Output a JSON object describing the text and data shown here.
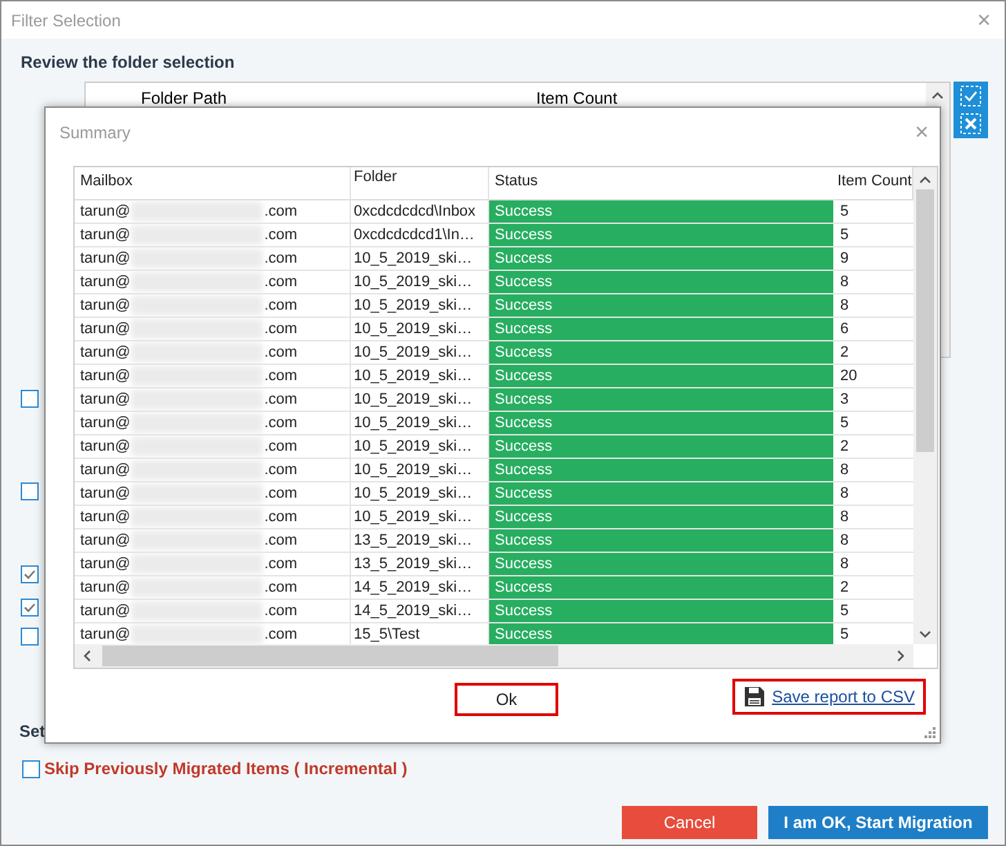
{
  "window": {
    "title": "Filter Selection",
    "close": "×"
  },
  "heading": "Review the folder selection",
  "folder_table": {
    "columns": [
      "Folder Path",
      "Item Count"
    ]
  },
  "options": [
    {
      "checked": false
    },
    {
      "checked": false
    },
    {
      "checked": true
    },
    {
      "checked": true
    },
    {
      "checked": false
    }
  ],
  "section_label": "Set",
  "incremental": {
    "label": "Skip Previously Migrated Items ( Incremental )",
    "checked": false
  },
  "buttons": [
    {
      "label": "Cancel",
      "kind": "cancel"
    },
    {
      "label": "I am OK, Start Migration",
      "kind": "primary"
    }
  ],
  "summary": {
    "title": "Summary",
    "close": "×",
    "columns": [
      "Mailbox",
      "Folder",
      "Status",
      "Item Count"
    ],
    "rows": [
      {
        "mailbox_user": "tarun@",
        "mailbox_domain": ".com",
        "folder": "0xcdcdcdcd\\Inbox",
        "status": "Success",
        "kind": "success",
        "item_count": "5"
      },
      {
        "mailbox_user": "tarun@",
        "mailbox_domain": ".com",
        "folder": "0xcdcdcdcd1\\In…",
        "status": "Success",
        "kind": "success",
        "item_count": "5"
      },
      {
        "mailbox_user": "tarun@",
        "mailbox_domain": ".com",
        "folder": "10_5_2019_ski…",
        "status": "Success",
        "kind": "success",
        "item_count": "9"
      },
      {
        "mailbox_user": "tarun@",
        "mailbox_domain": ".com",
        "folder": "10_5_2019_ski…",
        "status": "Success",
        "kind": "success",
        "item_count": "8"
      },
      {
        "mailbox_user": "tarun@",
        "mailbox_domain": ".com",
        "folder": "10_5_2019_ski…",
        "status": "Success",
        "kind": "success",
        "item_count": "8"
      },
      {
        "mailbox_user": "tarun@",
        "mailbox_domain": ".com",
        "folder": "10_5_2019_ski…",
        "status": "Success",
        "kind": "success",
        "item_count": "6"
      },
      {
        "mailbox_user": "tarun@",
        "mailbox_domain": ".com",
        "folder": "10_5_2019_ski…",
        "status": "Success",
        "kind": "success",
        "item_count": "2"
      },
      {
        "mailbox_user": "tarun@",
        "mailbox_domain": ".com",
        "folder": "10_5_2019_ski…",
        "status": "Success",
        "kind": "success",
        "item_count": "20"
      },
      {
        "mailbox_user": "tarun@",
        "mailbox_domain": ".com",
        "folder": "10_5_2019_ski…",
        "status": "Success",
        "kind": "success",
        "item_count": "3"
      },
      {
        "mailbox_user": "tarun@",
        "mailbox_domain": ".com",
        "folder": "10_5_2019_ski…",
        "status": "Success",
        "kind": "success",
        "item_count": "5"
      },
      {
        "mailbox_user": "tarun@",
        "mailbox_domain": ".com",
        "folder": "10_5_2019_ski…",
        "status": "Success",
        "kind": "success",
        "item_count": "2"
      },
      {
        "mailbox_user": "tarun@",
        "mailbox_domain": ".com",
        "folder": "10_5_2019_ski…",
        "status": "Success",
        "kind": "success",
        "item_count": "8"
      },
      {
        "mailbox_user": "tarun@",
        "mailbox_domain": ".com",
        "folder": "10_5_2019_ski…",
        "status": "Success",
        "kind": "success",
        "item_count": "8"
      },
      {
        "mailbox_user": "tarun@",
        "mailbox_domain": ".com",
        "folder": "10_5_2019_ski…",
        "status": "Success",
        "kind": "success",
        "item_count": "8"
      },
      {
        "mailbox_user": "tarun@",
        "mailbox_domain": ".com",
        "folder": "13_5_2019_ski…",
        "status": "Success",
        "kind": "success",
        "item_count": "8"
      },
      {
        "mailbox_user": "tarun@",
        "mailbox_domain": ".com",
        "folder": "13_5_2019_ski…",
        "status": "Success",
        "kind": "success",
        "item_count": "8"
      },
      {
        "mailbox_user": "tarun@",
        "mailbox_domain": ".com",
        "folder": "14_5_2019_ski…",
        "status": "Success",
        "kind": "success",
        "item_count": "2"
      },
      {
        "mailbox_user": "tarun@",
        "mailbox_domain": ".com",
        "folder": "14_5_2019_ski…",
        "status": "Success",
        "kind": "success",
        "item_count": "5"
      },
      {
        "mailbox_user": "tarun@",
        "mailbox_domain": ".com",
        "folder": "15_5\\Test",
        "status": "Success",
        "kind": "success",
        "item_count": "5"
      }
    ],
    "ok": "Ok",
    "save_link": "Save report to CSV"
  }
}
